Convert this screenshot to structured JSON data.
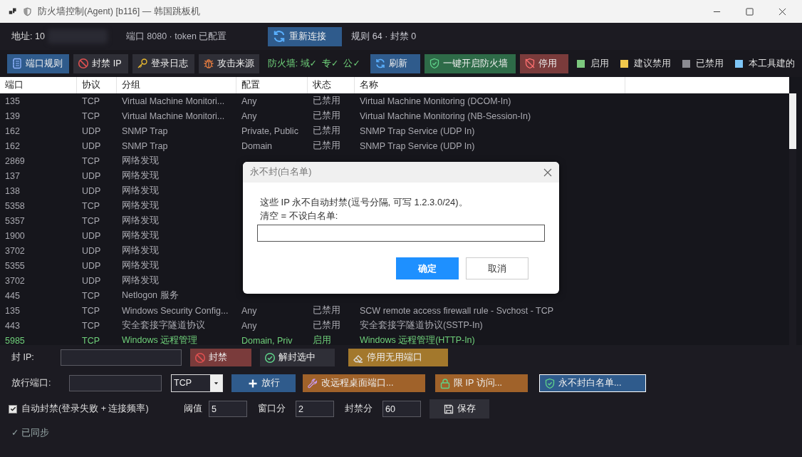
{
  "window": {
    "title": "防火墙控制(Agent) [b116] — 韩国跳板机"
  },
  "info_bar": {
    "address": "地址: 10",
    "port_token": "端口 8080 · token 已配置",
    "reconnect_button": "重新连接",
    "rule_summary": "规则 64 · 封禁 0"
  },
  "toolbar": {
    "tabs": [
      {
        "label": "端口规则",
        "selected": true
      },
      {
        "label": "封禁 IP",
        "selected": false
      },
      {
        "label": "登录日志",
        "selected": false
      },
      {
        "label": "攻击来源",
        "selected": false
      }
    ],
    "firewall_status": "防火墙: 域✓  专✓  公✓",
    "buttons": [
      {
        "label": "刷新",
        "kind": "primary"
      },
      {
        "label": "一键开启防火墙",
        "kind": "success"
      },
      {
        "label": "停用",
        "kind": "danger"
      }
    ],
    "legend": [
      {
        "label": "启用",
        "color": "#7cc87e"
      },
      {
        "label": "建议禁用",
        "color": "#f2c94c"
      },
      {
        "label": "已禁用",
        "color": "#8b8b92"
      },
      {
        "label": "本工具建的",
        "color": "#7ec6f7"
      }
    ]
  },
  "table": {
    "columns": [
      "端口",
      "协议",
      "分组",
      "配置",
      "状态",
      "名称"
    ],
    "rows": [
      {
        "port": "135",
        "protocol": "TCP",
        "group": "Virtual Machine Monitori...",
        "profile": "Any",
        "status": "已禁用",
        "name": "Virtual Machine Monitoring (DCOM-In)",
        "enabled": false
      },
      {
        "port": "139",
        "protocol": "TCP",
        "group": "Virtual Machine Monitori...",
        "profile": "Any",
        "status": "已禁用",
        "name": "Virtual Machine Monitoring (NB-Session-In)",
        "enabled": false
      },
      {
        "port": "162",
        "protocol": "UDP",
        "group": "SNMP Trap",
        "profile": "Private, Public",
        "status": "已禁用",
        "name": "SNMP Trap Service (UDP In)",
        "enabled": false
      },
      {
        "port": "162",
        "protocol": "UDP",
        "group": "SNMP Trap",
        "profile": "Domain",
        "status": "已禁用",
        "name": "SNMP Trap Service (UDP In)",
        "enabled": false
      },
      {
        "port": "2869",
        "protocol": "TCP",
        "group": "网络发现",
        "enabled": false
      },
      {
        "port": "137",
        "protocol": "UDP",
        "group": "网络发现",
        "enabled": false
      },
      {
        "port": "138",
        "protocol": "UDP",
        "group": "网络发现",
        "enabled": false
      },
      {
        "port": "5358",
        "protocol": "TCP",
        "group": "网络发现",
        "enabled": false
      },
      {
        "port": "5357",
        "protocol": "TCP",
        "group": "网络发现",
        "enabled": false
      },
      {
        "port": "1900",
        "protocol": "UDP",
        "group": "网络发现",
        "enabled": false
      },
      {
        "port": "3702",
        "protocol": "UDP",
        "group": "网络发现",
        "enabled": false
      },
      {
        "port": "5355",
        "protocol": "UDP",
        "group": "网络发现",
        "enabled": false
      },
      {
        "port": "3702",
        "protocol": "UDP",
        "group": "网络发现",
        "enabled": false
      },
      {
        "port": "445",
        "protocol": "TCP",
        "group": "Netlogon 服务",
        "enabled": false
      },
      {
        "port": "135",
        "protocol": "TCP",
        "group": "Windows Security Config...",
        "profile": "Any",
        "status": "已禁用",
        "name": "SCW remote access firewall rule - Svchost - TCP",
        "enabled": false
      },
      {
        "port": "443",
        "protocol": "TCP",
        "group": "安全套接字隧道协议",
        "profile": "Any",
        "status": "已禁用",
        "name": "安全套接字隧道协议(SSTP-In)",
        "enabled": false
      },
      {
        "port": "5985",
        "protocol": "TCP",
        "group": "Windows 远程管理",
        "profile": "Domain, Priv",
        "status": "启用",
        "name": "Windows 远程管理(HTTP-In)",
        "enabled": true
      }
    ]
  },
  "dialog": {
    "title": "永不封(白名单)",
    "message": "这些 IP 永不自动封禁(逗号分隔, 可写 1.2.3.0/24)。",
    "hint": "清空 = 不设白名单:",
    "buttons": [
      {
        "label": "确定",
        "kind": "primary"
      },
      {
        "label": "取消",
        "kind": "secondary"
      }
    ]
  },
  "bottom_panel": {
    "ban_ip": {
      "label": "封 IP:",
      "buttons": [
        {
          "label": "封禁",
          "kind": "danger"
        },
        {
          "label": "解封选中",
          "kind": "neutral"
        },
        {
          "label": "停用无用端口",
          "kind": "warning"
        }
      ]
    },
    "allow_port": {
      "label": "放行端口:",
      "protocol": "TCP",
      "buttons": [
        {
          "label": "放行",
          "kind": "primary",
          "focused": false
        },
        {
          "label": "改远程桌面端口...",
          "kind": "orange",
          "focused": false
        },
        {
          "label": "限 IP 访问...",
          "kind": "orange",
          "focused": false
        },
        {
          "label": "永不封白名单...",
          "kind": "primary",
          "focused": true
        }
      ]
    },
    "auto_ban": {
      "label": "自动封禁(登录失败 + 连接频率)",
      "checked": true,
      "fields": [
        {
          "label": "阈值",
          "value": "5"
        },
        {
          "label": "窗口分",
          "value": "2"
        },
        {
          "label": "封禁分",
          "value": "60"
        }
      ],
      "save_button": "保存"
    },
    "status": "✓ 已同步"
  }
}
